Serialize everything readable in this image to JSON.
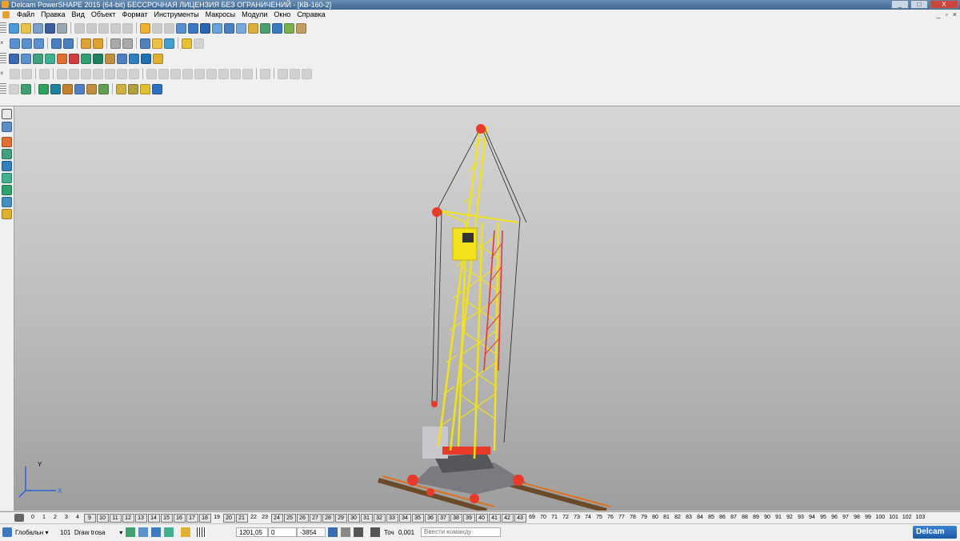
{
  "window": {
    "title": "Delcam PowerSHAPE 2015 (64-bit) БЕССРОЧНАЯ ЛИЦЕНЗИЯ БЕЗ ОГРАНИЧЕНИЙ - [КВ-160-2]",
    "min": "_",
    "max": "□",
    "close": "X"
  },
  "menu": {
    "items": [
      "Файл",
      "Правка",
      "Вид",
      "Объект",
      "Формат",
      "Инструменты",
      "Макросы",
      "Модули",
      "Окно",
      "Справка"
    ],
    "mdi_min": "_",
    "mdi_restore": "▫",
    "mdi_close": "×"
  },
  "toolbar_close": "×",
  "viewport": {
    "axis_y": "Y",
    "axis_x": "X"
  },
  "levels": {
    "items": [
      "0",
      "1",
      "2",
      "3",
      "4",
      "9",
      "10",
      "11",
      "12",
      "13",
      "14",
      "15",
      "16",
      "17",
      "18",
      "19",
      "20",
      "21",
      "22",
      "23",
      "24",
      "25",
      "26",
      "27",
      "28",
      "29",
      "30",
      "31",
      "32",
      "33",
      "34",
      "35",
      "36",
      "37",
      "38",
      "39",
      "40",
      "41",
      "42",
      "43",
      "69",
      "70",
      "71",
      "72",
      "73",
      "74",
      "75",
      "76",
      "77",
      "78",
      "79",
      "80",
      "81",
      "82",
      "83",
      "84",
      "85",
      "86",
      "87",
      "88",
      "89",
      "90",
      "91",
      "92",
      "93",
      "94",
      "95",
      "96",
      "97",
      "98",
      "99",
      "100",
      "101",
      "102",
      "103"
    ],
    "boxed": [
      "9",
      "10",
      "11",
      "12",
      "13",
      "14",
      "15",
      "16",
      "17",
      "18",
      "20",
      "21",
      "24",
      "25",
      "26",
      "27",
      "28",
      "29",
      "30",
      "31",
      "32",
      "33",
      "34",
      "35",
      "36",
      "37",
      "38",
      "39",
      "40",
      "41",
      "42",
      "43"
    ]
  },
  "status": {
    "workplane": "Глобальн",
    "workplane_arrow": "▾",
    "level_num": "101",
    "level_name": "Draw trosa",
    "level_arrow": "▾",
    "coord_x": "1201,05",
    "coord_y": "0",
    "coord_z": "-3854",
    "tol_label": "Точ",
    "tol_value": "0,001",
    "command_placeholder": "Ввести команду",
    "logo": "Delcam"
  },
  "colors": {
    "crane_yellow": "#f2e21c",
    "crane_red": "#e83a2a",
    "rail_brown": "#6b4a2a"
  }
}
